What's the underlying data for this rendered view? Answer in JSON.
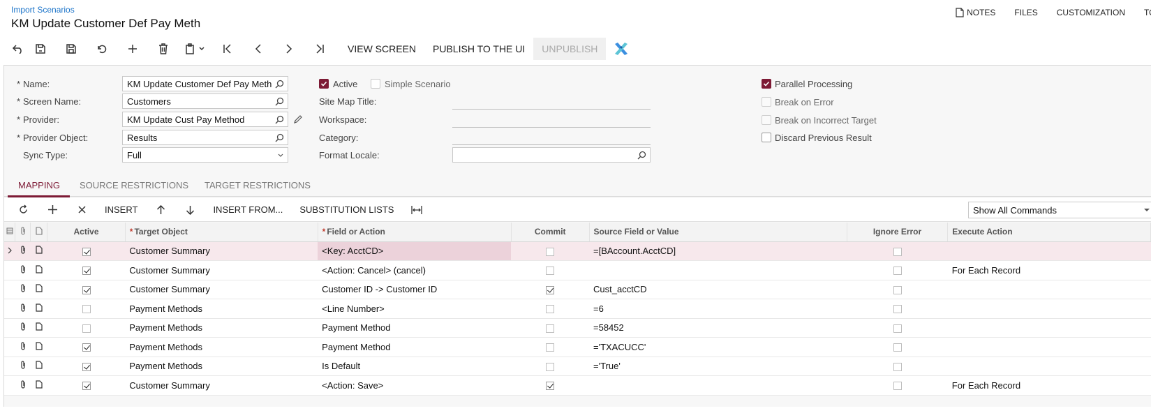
{
  "header": {
    "breadcrumb": "Import Scenarios",
    "title": "KM Update Customer Def Pay Meth",
    "links": {
      "notes": "NOTES",
      "files": "FILES",
      "customization": "CUSTOMIZATION",
      "tools": "TOOLS"
    }
  },
  "toolbar": {
    "view_screen": "VIEW SCREEN",
    "publish": "PUBLISH TO THE UI",
    "unpublish": "UNPUBLISH"
  },
  "form": {
    "name_label": "Name:",
    "name_value": "KM Update Customer Def Pay Meth",
    "screen_name_label": "Screen Name:",
    "screen_name_value": "Customers",
    "provider_label": "Provider:",
    "provider_value": "KM Update Cust Pay Method",
    "provider_object_label": "Provider Object:",
    "provider_object_value": "Results",
    "sync_type_label": "Sync Type:",
    "sync_type_value": "Full",
    "active_label": "Active",
    "simple_scenario_label": "Simple Scenario",
    "site_map_title_label": "Site Map Title:",
    "workspace_label": "Workspace:",
    "category_label": "Category:",
    "format_locale_label": "Format Locale:",
    "parallel_processing_label": "Parallel Processing",
    "break_on_error_label": "Break on Error",
    "break_on_incorrect_target_label": "Break on Incorrect Target",
    "discard_previous_result_label": "Discard Previous Result"
  },
  "tabs": {
    "mapping": "MAPPING",
    "source_restrictions": "SOURCE RESTRICTIONS",
    "target_restrictions": "TARGET RESTRICTIONS"
  },
  "grid_toolbar": {
    "insert": "INSERT",
    "insert_from": "INSERT FROM...",
    "substitution_lists": "SUBSTITUTION LISTS",
    "show_commands": "Show All Commands"
  },
  "grid": {
    "columns": {
      "active": "Active",
      "target_object": "Target Object",
      "field_or_action": "Field or Action",
      "commit": "Commit",
      "source_field": "Source Field or Value",
      "ignore_error": "Ignore Error",
      "execute_action": "Execute Action"
    },
    "rows": [
      {
        "active": true,
        "target": "Customer Summary",
        "field": "<Key: AcctCD>",
        "commit": false,
        "source": "=[BAccount.AcctCD]",
        "ignore": false,
        "execute": ""
      },
      {
        "active": true,
        "target": "Customer Summary",
        "field": "<Action: Cancel> (cancel)",
        "commit": false,
        "source": "",
        "ignore": false,
        "execute": "For Each Record"
      },
      {
        "active": true,
        "target": "Customer Summary",
        "field": "Customer ID -> Customer ID",
        "commit": true,
        "source": "Cust_acctCD",
        "ignore": false,
        "execute": ""
      },
      {
        "active": false,
        "target": "Payment Methods",
        "field": "<Line Number>",
        "commit": false,
        "source": "=6",
        "ignore": false,
        "execute": ""
      },
      {
        "active": false,
        "target": "Payment Methods",
        "field": "Payment Method",
        "commit": false,
        "source": "=58452",
        "ignore": false,
        "execute": ""
      },
      {
        "active": true,
        "target": "Payment Methods",
        "field": "Payment Method",
        "commit": false,
        "source": "='TXACUCC'",
        "ignore": false,
        "execute": ""
      },
      {
        "active": true,
        "target": "Payment Methods",
        "field": "Is Default",
        "commit": false,
        "source": "='True'",
        "ignore": false,
        "execute": ""
      },
      {
        "active": true,
        "target": "Customer Summary",
        "field": "<Action: Save>",
        "commit": true,
        "source": "",
        "ignore": false,
        "execute": "For Each Record"
      }
    ]
  },
  "colors": {
    "accent": "#7d1a35",
    "link": "#1a73c9"
  }
}
